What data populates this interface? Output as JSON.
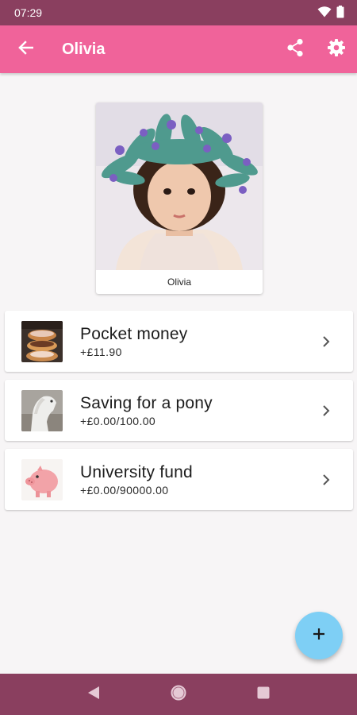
{
  "status_bar": {
    "time": "07:29",
    "icons": [
      "wifi-icon",
      "battery-icon"
    ]
  },
  "app_bar": {
    "title": "Olivia",
    "back_icon": "arrow-back-icon",
    "actions": [
      "share-icon",
      "settings-gear-icon"
    ]
  },
  "colors": {
    "status_bar": "#8a3f5f",
    "app_bar": "#f0639a",
    "fab": "#7ecff5",
    "background": "#f7f5f6"
  },
  "profile": {
    "name": "Olivia",
    "photo": "child-with-flower-crown-photo"
  },
  "accounts": [
    {
      "name": "Pocket money",
      "balance": "+£11.90",
      "thumb": "donuts-photo"
    },
    {
      "name": "Saving for a pony",
      "balance": "+£0.00/100.00",
      "thumb": "white-pony-photo"
    },
    {
      "name": "University fund",
      "balance": "+£0.00/90000.00",
      "thumb": "piggy-bank-photo"
    }
  ],
  "fab": {
    "icon": "plus-icon"
  },
  "nav_bar": {
    "icons": [
      "nav-back-icon",
      "nav-home-icon",
      "nav-recents-icon"
    ]
  }
}
